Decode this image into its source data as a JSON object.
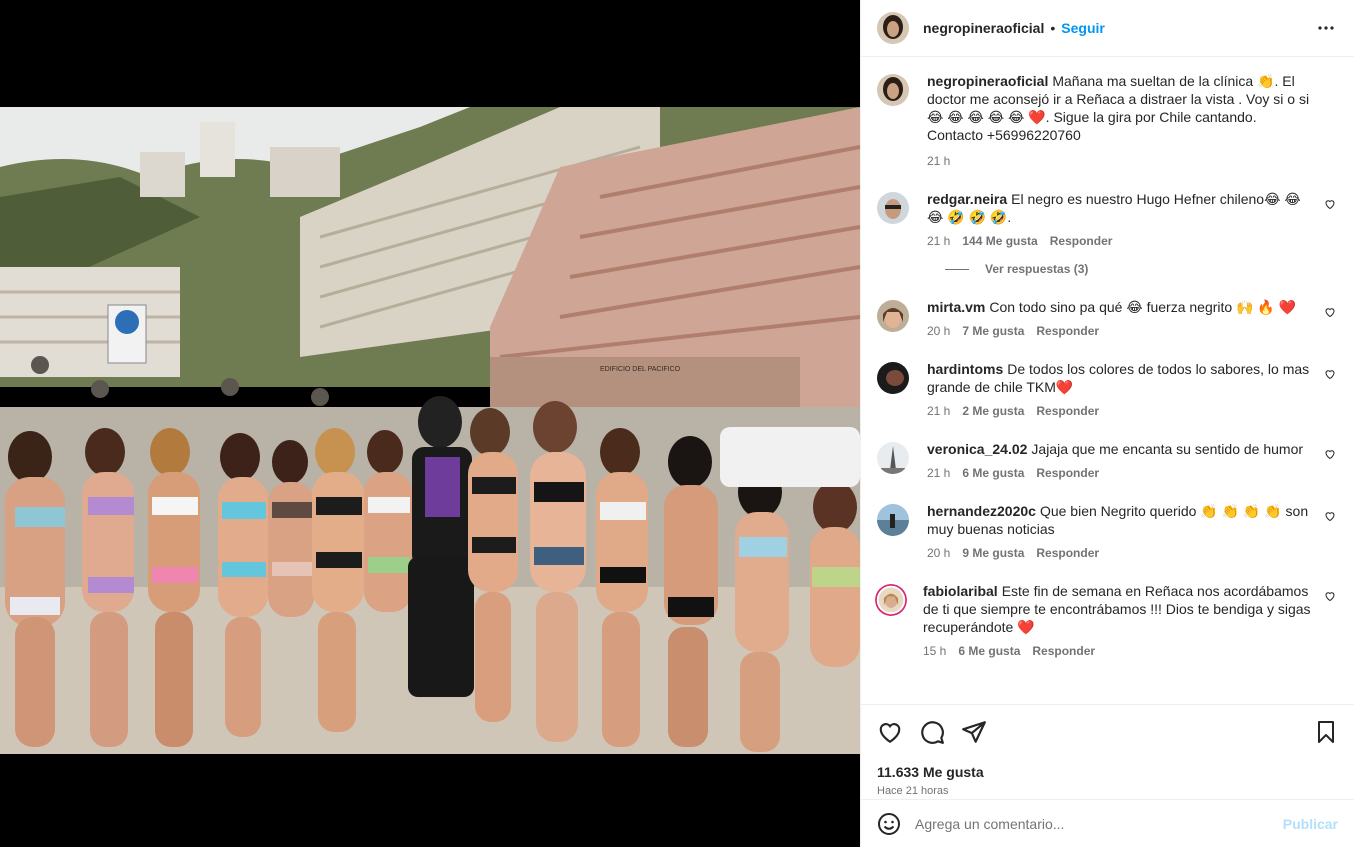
{
  "post": {
    "author": "negropineraoficial",
    "follow_label": "Seguir",
    "separator": "•",
    "caption": "Mañana ma sueltan de la clínica 👏. El doctor me aconsejó ir a Reñaca a distraer la vista . Voy si o si😂 😂 😂 😂 😂 ❤️. Sigue la gira por Chile cantando. Contacto +56996220760",
    "caption_time": "21 h"
  },
  "comments": [
    {
      "user": "redgar.neira",
      "text": "El negro es nuestro Hugo Hefner chileno😂 😂 😂 🤣 🤣 🤣.",
      "time": "21 h",
      "likes": "144 Me gusta",
      "reply": "Responder",
      "replies": "Ver respuestas (3)"
    },
    {
      "user": "mirta.vm",
      "text": "Con todo sino pa qué 😂 fuerza negrito 🙌 🔥 ❤️",
      "time": "20 h",
      "likes": "7 Me gusta",
      "reply": "Responder"
    },
    {
      "user": "hardintoms",
      "text": "De todos los colores de todos lo sabores, lo mas grande de chile TKM❤️",
      "time": "21 h",
      "likes": "2 Me gusta",
      "reply": "Responder"
    },
    {
      "user": "veronica_24.02",
      "text": "Jajaja que me encanta su sentido de humor",
      "time": "21 h",
      "likes": "6 Me gusta",
      "reply": "Responder"
    },
    {
      "user": "hernandez2020c",
      "text": "Que bien Negrito querido 👏 👏 👏 👏 son muy buenas noticias",
      "time": "20 h",
      "likes": "9 Me gusta",
      "reply": "Responder"
    },
    {
      "user": "fabiolaribal",
      "text": "Este fin de semana en Reñaca nos acordábamos de ti que siempre te encontrábamos !!! Dios te bendiga y sigas recuperándote ❤️",
      "time": "15 h",
      "likes": "6 Me gusta",
      "reply": "Responder"
    }
  ],
  "footer": {
    "likes": "11.633 Me gusta",
    "posted": "Hace 21 horas",
    "comment_placeholder": "Agrega un comentario...",
    "publish": "Publicar"
  },
  "icons": {
    "more": "more-icon",
    "like": "heart-icon",
    "comment": "comment-icon",
    "share": "share-icon",
    "save": "bookmark-icon",
    "emoji": "emoji-icon"
  },
  "colors": {
    "accent": "#0095f6",
    "muted": "#737373",
    "publish_disabled": "#b2dffc"
  },
  "photo_signs": {
    "building_sign": "EDIFICIO DEL PACIFICO"
  }
}
